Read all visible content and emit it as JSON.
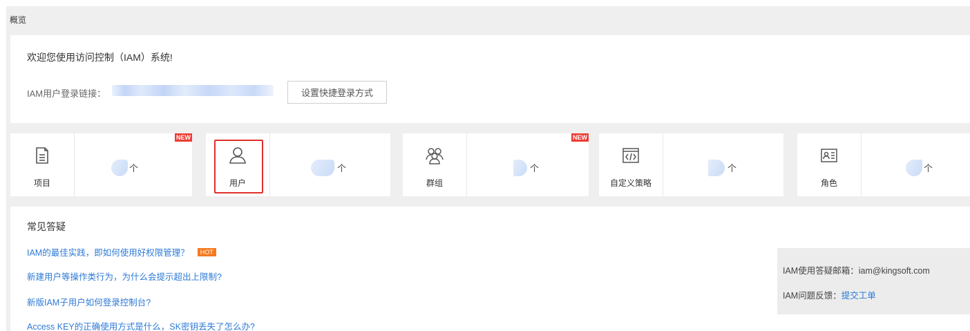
{
  "page": {
    "tab_title": "概览"
  },
  "welcome": {
    "title": "欢迎您使用访问控制（IAM）系统!",
    "login_label": "IAM用户登录链接：",
    "quick_login_button": "设置快捷登录方式"
  },
  "cards": [
    {
      "label": "项目",
      "icon": "document-icon",
      "unit": "个",
      "new_badge": "NEW",
      "highlighted": false
    },
    {
      "label": "用户",
      "icon": "user-icon",
      "unit": "个",
      "new_badge": "",
      "highlighted": true
    },
    {
      "label": "群组",
      "icon": "group-icon",
      "unit": "个",
      "new_badge": "NEW",
      "highlighted": false
    },
    {
      "label": "自定义策略",
      "icon": "code-window-icon",
      "unit": "个",
      "new_badge": "",
      "highlighted": false
    },
    {
      "label": "角色",
      "icon": "id-card-icon",
      "unit": "个",
      "new_badge": "",
      "highlighted": false
    }
  ],
  "faq": {
    "title": "常见答疑",
    "items": [
      {
        "text": "IAM的最佳实践，即如何使用好权限管理？",
        "badge": "HOT"
      },
      {
        "text": "新建用户等操作类行为，为什么会提示超出上限制?",
        "badge": ""
      },
      {
        "text": "新版IAM子用户如何登录控制台?",
        "badge": ""
      },
      {
        "text": "Access KEY的正确使用方式是什么，SK密钥丢失了怎么办?",
        "badge": ""
      }
    ]
  },
  "contact": {
    "email_label": "IAM使用答疑邮箱：",
    "email": "iam@kingsoft.com",
    "feedback_label": "IAM问题反馈：",
    "feedback_link": "提交工单"
  },
  "colors": {
    "link": "#2e7ad6",
    "highlight": "#e0302a",
    "new_badge": "#ee3c32",
    "hot_badge": "#f47a20"
  }
}
